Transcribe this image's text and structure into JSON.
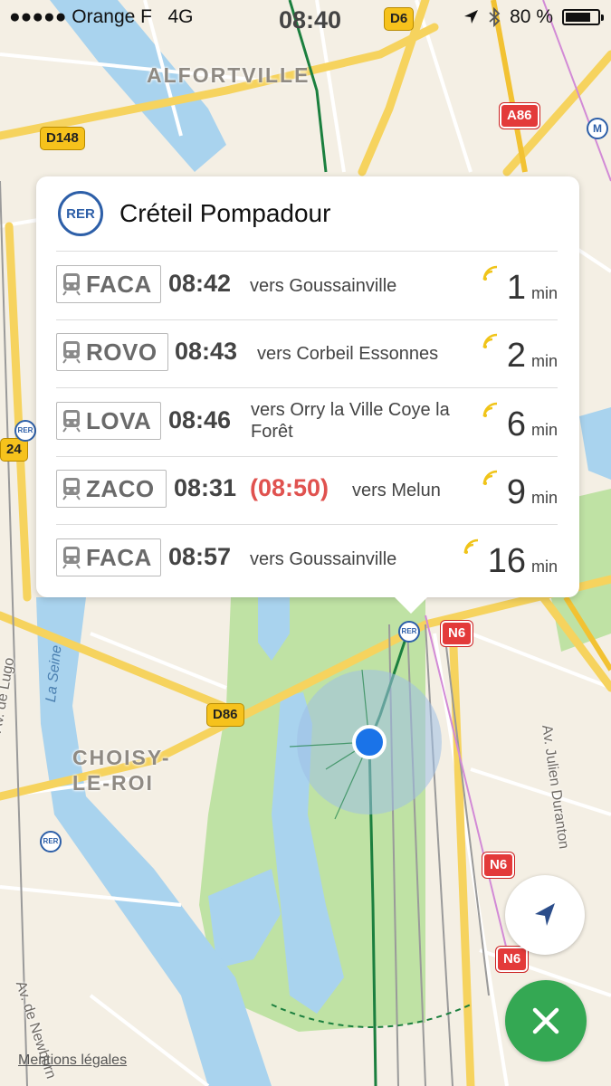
{
  "status_bar": {
    "carrier": "●●●●● Orange F",
    "network": "4G",
    "time": "08:40",
    "battery": "80 %",
    "battery_level": 0.8
  },
  "map": {
    "places": [
      "ALFORTVILLE",
      "CHOISY-",
      "LE-ROI"
    ],
    "road_shields": [
      "D6",
      "D148",
      "A86",
      "24",
      "D86",
      "N6",
      "N6",
      "N6"
    ],
    "streets": [
      "Av. de Lugo",
      "Av. Julien Duranton",
      "Av. de Newburn"
    ],
    "river": "La Seine",
    "metro_badge": "M",
    "rer_badge": "RER",
    "legal_link": "Mentions légales"
  },
  "station": {
    "logo_text": "RER",
    "name": "Créteil Pompadour"
  },
  "departures": [
    {
      "code": "FACA",
      "time": "08:42",
      "delayed_time": "",
      "destination": "vers Goussainville",
      "wait": "1",
      "unit": "min"
    },
    {
      "code": "ROVO",
      "time": "08:43",
      "delayed_time": "",
      "destination": "vers Corbeil Essonnes",
      "wait": "2",
      "unit": "min"
    },
    {
      "code": "LOVA",
      "time": "08:46",
      "delayed_time": "",
      "destination": "vers Orry la Ville Coye la Forêt",
      "wait": "6",
      "unit": "min"
    },
    {
      "code": "ZACO",
      "time": "08:31",
      "delayed_time": "(08:50)",
      "destination": "vers Melun",
      "wait": "9",
      "unit": "min"
    },
    {
      "code": "FACA",
      "time": "08:57",
      "delayed_time": "",
      "destination": "vers Goussainville",
      "wait": "16",
      "unit": "min"
    }
  ],
  "colors": {
    "rer_blue": "#2d5fa8",
    "delay_red": "#e0524f",
    "realtime_yellow": "#f0c419",
    "close_green": "#34a853",
    "location_blue": "#1a73e8"
  }
}
